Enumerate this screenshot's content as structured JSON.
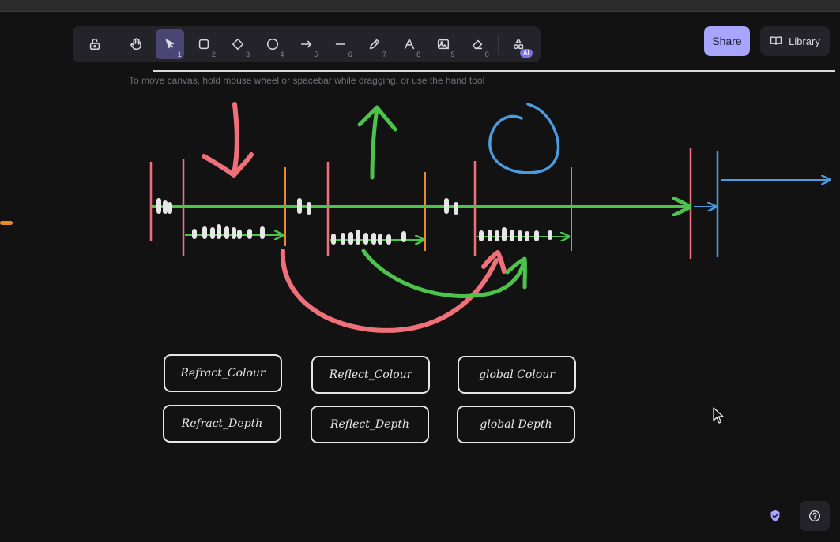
{
  "toolbar": {
    "tools": [
      {
        "name": "lock",
        "key": ""
      },
      {
        "name": "hand",
        "key": ""
      },
      {
        "name": "selection",
        "key": "1"
      },
      {
        "name": "rectangle",
        "key": "2"
      },
      {
        "name": "diamond",
        "key": "3"
      },
      {
        "name": "ellipse",
        "key": "4"
      },
      {
        "name": "arrow",
        "key": "5"
      },
      {
        "name": "line",
        "key": "6"
      },
      {
        "name": "draw",
        "key": "7"
      },
      {
        "name": "text",
        "key": "8"
      },
      {
        "name": "image",
        "key": "9"
      },
      {
        "name": "eraser",
        "key": "0"
      },
      {
        "name": "more-tools",
        "key": ""
      }
    ],
    "ai_badge": "AI",
    "active_tool": "selection"
  },
  "hint": "To move canvas, hold mouse wheel or spacebar while dragging, or use the hand tool",
  "share_label": "Share",
  "library_label": "Library",
  "canvas": {
    "boxes": [
      {
        "id": "refract-colour",
        "label": "Refract_Colour"
      },
      {
        "id": "reflect-colour",
        "label": "Reflect_Colour"
      },
      {
        "id": "global-colour",
        "label": "global Colour"
      },
      {
        "id": "refract-depth",
        "label": "Refract_Depth"
      },
      {
        "id": "reflect-depth",
        "label": "Reflect_Depth"
      },
      {
        "id": "global-depth",
        "label": "global Depth"
      }
    ]
  },
  "colors": {
    "red": "#f0707a",
    "green": "#4cc44c",
    "blue": "#4a9be0",
    "orange": "#e8892e",
    "accent": "#a8a5ff"
  }
}
